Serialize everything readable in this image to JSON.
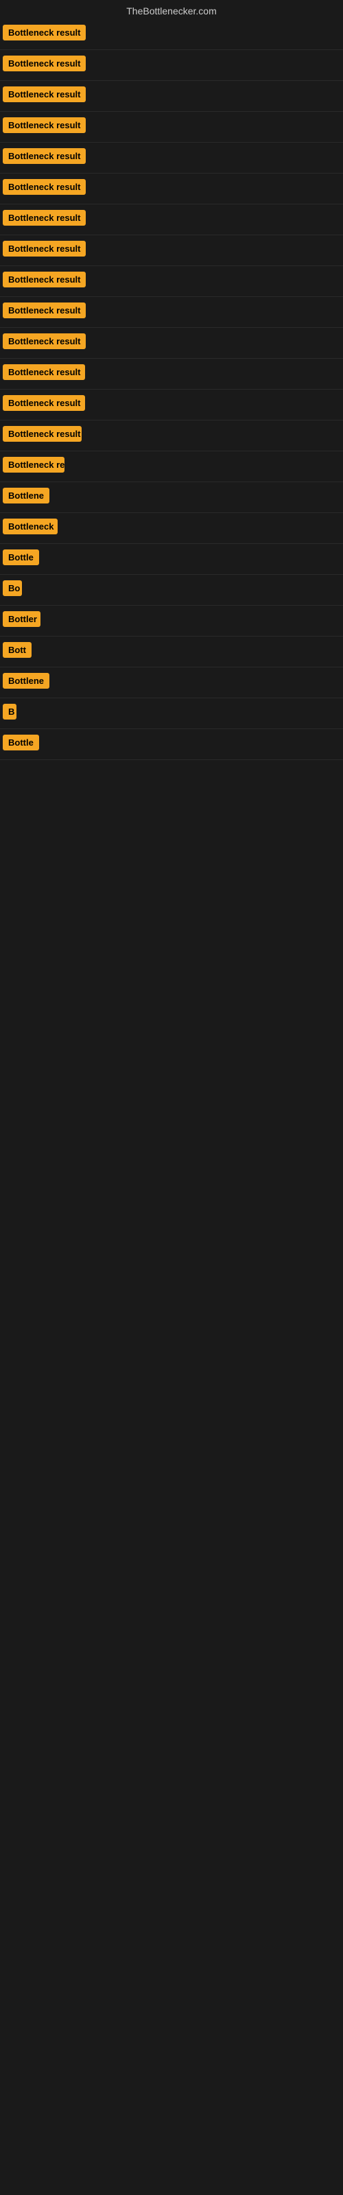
{
  "site": {
    "title": "TheBottlenecker.com"
  },
  "rows": [
    {
      "id": 1,
      "label": "Bottleneck result",
      "width": 130
    },
    {
      "id": 2,
      "label": "Bottleneck result",
      "width": 130
    },
    {
      "id": 3,
      "label": "Bottleneck result",
      "width": 130
    },
    {
      "id": 4,
      "label": "Bottleneck result",
      "width": 130
    },
    {
      "id": 5,
      "label": "Bottleneck result",
      "width": 130
    },
    {
      "id": 6,
      "label": "Bottleneck result",
      "width": 130
    },
    {
      "id": 7,
      "label": "Bottleneck result",
      "width": 130
    },
    {
      "id": 8,
      "label": "Bottleneck result",
      "width": 130
    },
    {
      "id": 9,
      "label": "Bottleneck result",
      "width": 130
    },
    {
      "id": 10,
      "label": "Bottleneck result",
      "width": 130
    },
    {
      "id": 11,
      "label": "Bottleneck result",
      "width": 130
    },
    {
      "id": 12,
      "label": "Bottleneck result",
      "width": 120
    },
    {
      "id": 13,
      "label": "Bottleneck result",
      "width": 120
    },
    {
      "id": 14,
      "label": "Bottleneck result",
      "width": 115
    },
    {
      "id": 15,
      "label": "Bottleneck re",
      "width": 90
    },
    {
      "id": 16,
      "label": "Bottlene",
      "width": 70
    },
    {
      "id": 17,
      "label": "Bottleneck",
      "width": 80
    },
    {
      "id": 18,
      "label": "Bottle",
      "width": 58
    },
    {
      "id": 19,
      "label": "Bo",
      "width": 28
    },
    {
      "id": 20,
      "label": "Bottler",
      "width": 55
    },
    {
      "id": 21,
      "label": "Bott",
      "width": 42
    },
    {
      "id": 22,
      "label": "Bottlene",
      "width": 68
    },
    {
      "id": 23,
      "label": "B",
      "width": 20
    },
    {
      "id": 24,
      "label": "Bottle",
      "width": 55
    }
  ]
}
